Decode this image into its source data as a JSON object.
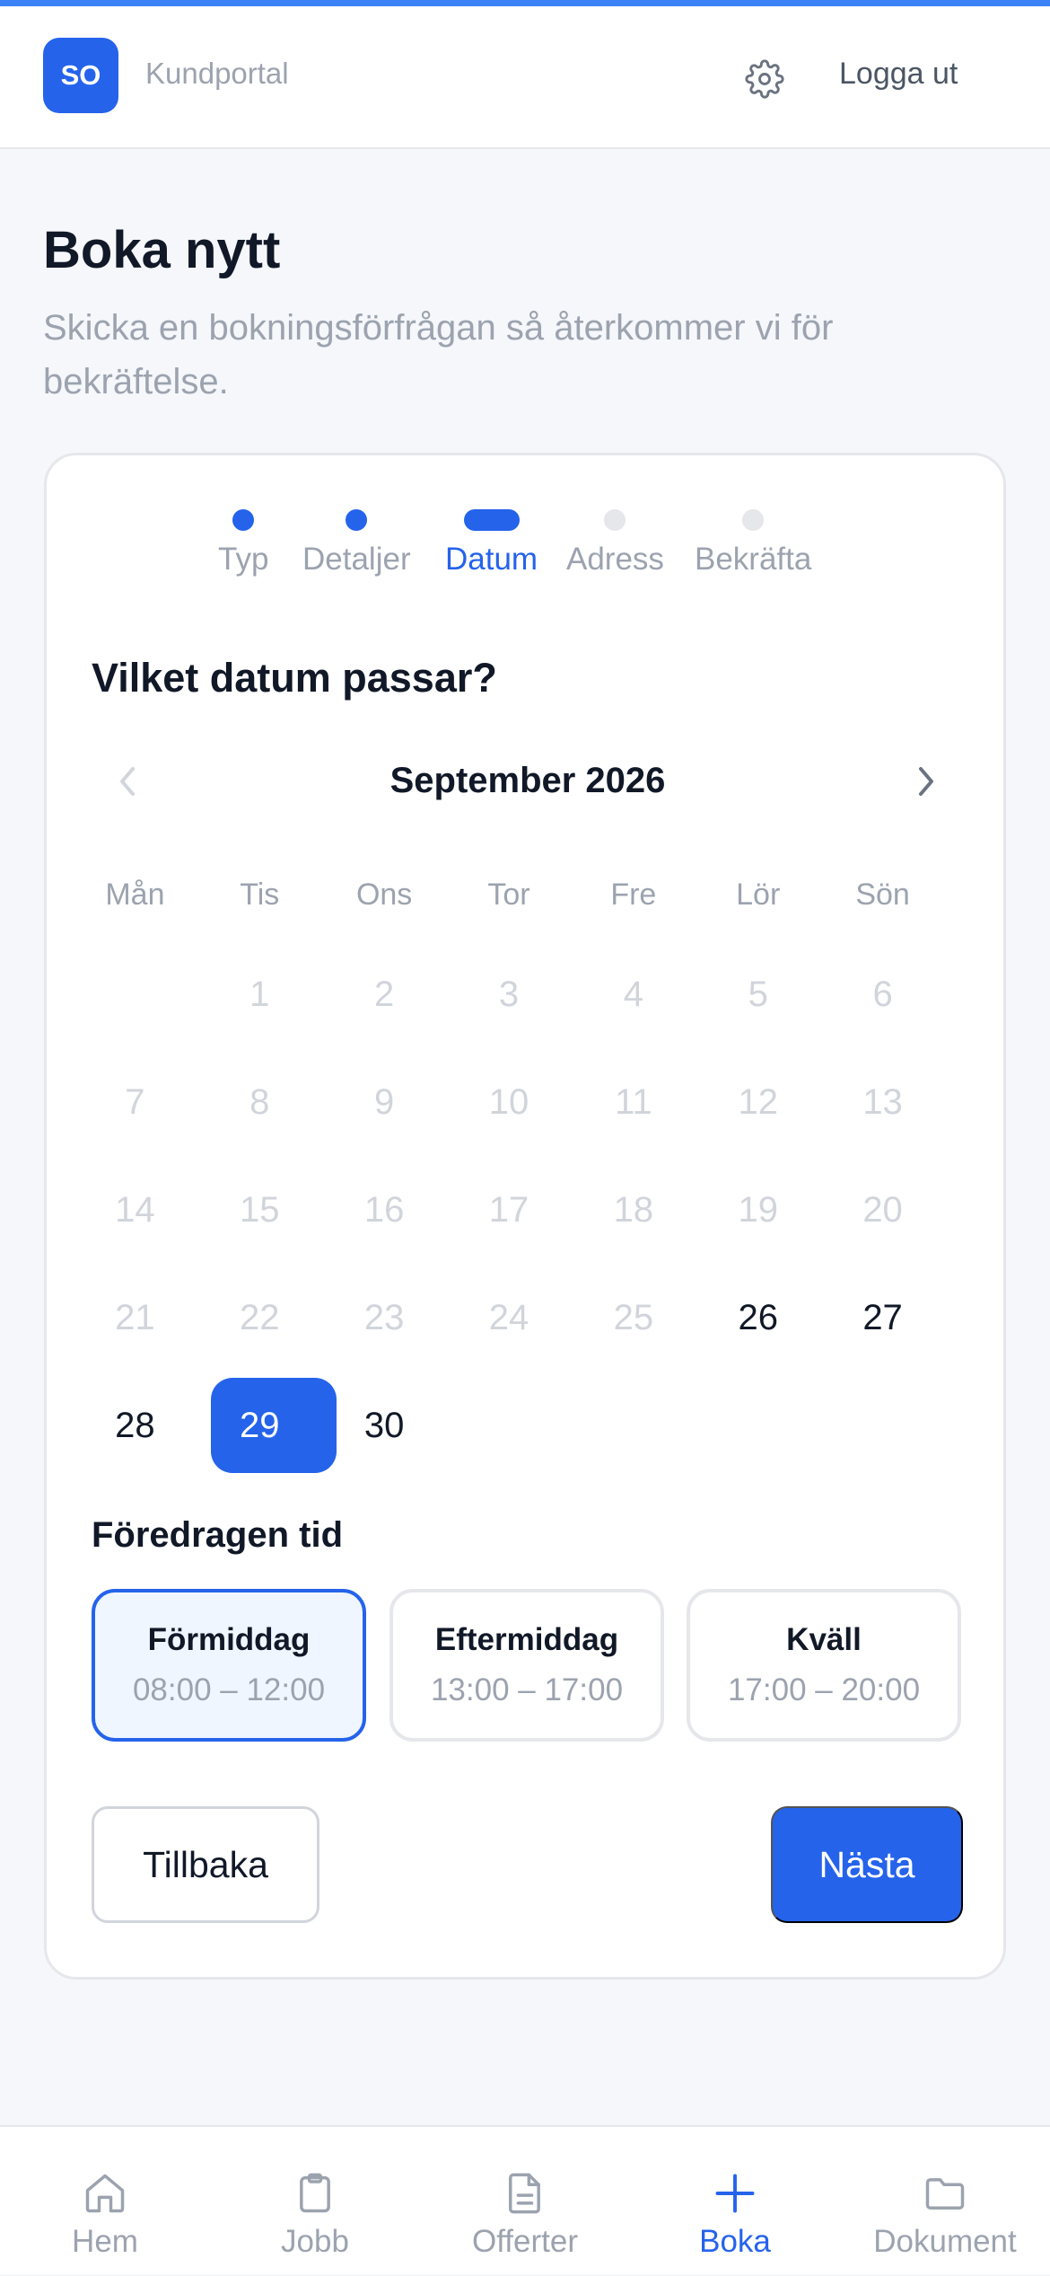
{
  "app": {
    "logo_text": "SO",
    "portal_name": "Kundportal",
    "logout_label": "Logga ut"
  },
  "page": {
    "title": "Boka nytt",
    "subtitle": "Skicka en bokningsförfrågan så återkommer vi för bekräftelse."
  },
  "stepper": {
    "steps": [
      {
        "label": "Typ",
        "state": "done"
      },
      {
        "label": "Detaljer",
        "state": "done"
      },
      {
        "label": "Datum",
        "state": "active"
      },
      {
        "label": "Adress",
        "state": "pending"
      },
      {
        "label": "Bekräfta",
        "state": "pending"
      }
    ]
  },
  "question": "Vilket datum passar?",
  "calendar": {
    "month_label": "September 2026",
    "weekdays": [
      "Mån",
      "Tis",
      "Ons",
      "Tor",
      "Fre",
      "Lör",
      "Sön"
    ],
    "leading_blank_days": 1,
    "days": [
      {
        "n": "1",
        "state": "disabled"
      },
      {
        "n": "2",
        "state": "disabled"
      },
      {
        "n": "3",
        "state": "disabled"
      },
      {
        "n": "4",
        "state": "disabled"
      },
      {
        "n": "5",
        "state": "disabled"
      },
      {
        "n": "6",
        "state": "disabled"
      },
      {
        "n": "7",
        "state": "disabled"
      },
      {
        "n": "8",
        "state": "disabled"
      },
      {
        "n": "9",
        "state": "disabled"
      },
      {
        "n": "10",
        "state": "disabled"
      },
      {
        "n": "11",
        "state": "disabled"
      },
      {
        "n": "12",
        "state": "disabled"
      },
      {
        "n": "13",
        "state": "disabled"
      },
      {
        "n": "14",
        "state": "disabled"
      },
      {
        "n": "15",
        "state": "disabled"
      },
      {
        "n": "16",
        "state": "disabled"
      },
      {
        "n": "17",
        "state": "disabled"
      },
      {
        "n": "18",
        "state": "disabled"
      },
      {
        "n": "19",
        "state": "disabled"
      },
      {
        "n": "20",
        "state": "disabled"
      },
      {
        "n": "21",
        "state": "disabled"
      },
      {
        "n": "22",
        "state": "disabled"
      },
      {
        "n": "23",
        "state": "disabled"
      },
      {
        "n": "24",
        "state": "disabled"
      },
      {
        "n": "25",
        "state": "disabled"
      },
      {
        "n": "26",
        "state": "available"
      },
      {
        "n": "27",
        "state": "available"
      },
      {
        "n": "28",
        "state": "available"
      },
      {
        "n": "29",
        "state": "selected"
      },
      {
        "n": "30",
        "state": "available"
      }
    ]
  },
  "time": {
    "title": "Föredragen tid",
    "slots": [
      {
        "name": "Förmiddag",
        "range": "08:00 – 12:00",
        "selected": true
      },
      {
        "name": "Eftermiddag",
        "range": "13:00 – 17:00",
        "selected": false
      },
      {
        "name": "Kväll",
        "range": "17:00 – 20:00",
        "selected": false
      }
    ]
  },
  "actions": {
    "back_label": "Tillbaka",
    "next_label": "Nästa"
  },
  "nav": {
    "items": [
      {
        "label": "Hem",
        "icon": "home-icon",
        "active": false
      },
      {
        "label": "Jobb",
        "icon": "clipboard-icon",
        "active": false
      },
      {
        "label": "Offerter",
        "icon": "document-icon",
        "active": false
      },
      {
        "label": "Boka",
        "icon": "plus-icon",
        "active": true
      },
      {
        "label": "Dokument",
        "icon": "folder-icon",
        "active": false
      }
    ]
  },
  "colors": {
    "accent": "#2563eb",
    "accent_light": "#eff6ff",
    "muted_text": "#9ca3af",
    "disabled_day": "#d1d5db",
    "border": "#e5e7eb"
  }
}
